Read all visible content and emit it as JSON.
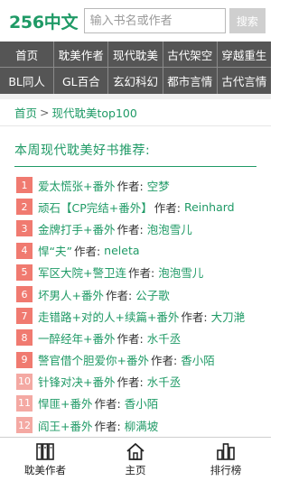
{
  "header": {
    "logo": "256中文",
    "search_placeholder": "输入书名或作者",
    "search_button": "搜索"
  },
  "nav": {
    "row1": [
      "首页",
      "耽美作者",
      "现代耽美",
      "古代架空",
      "穿越重生"
    ],
    "row2": [
      "BL同人",
      "GL百合",
      "玄幻科幻",
      "都市言情",
      "古代言情"
    ]
  },
  "breadcrumb": {
    "home": "首页",
    "separator": ">",
    "current": "现代耽美top100"
  },
  "section_title": "本周现代耽美好书推荐:",
  "author_label": "作者:",
  "books": [
    {
      "rank": "1",
      "title": "爱太慌张+番外",
      "author": "空梦"
    },
    {
      "rank": "2",
      "title": "顽石【CP完结+番外】",
      "author": "Reinhard"
    },
    {
      "rank": "3",
      "title": "金牌打手+番外",
      "author": "泡泡雪儿"
    },
    {
      "rank": "4",
      "title": "悍“夫”",
      "author": "neleta"
    },
    {
      "rank": "5",
      "title": "军区大院+警卫连",
      "author": "泡泡雪儿"
    },
    {
      "rank": "6",
      "title": "坏男人+番外",
      "author": "公子歌"
    },
    {
      "rank": "7",
      "title": "走错路+对的人+续篇+番外",
      "author": "大刀滟"
    },
    {
      "rank": "8",
      "title": "一醉经年+番外",
      "author": "水千丞"
    },
    {
      "rank": "9",
      "title": "警官借个胆爱你+番外",
      "author": "香小陌"
    },
    {
      "rank": "10",
      "title": "针锋对决+番外",
      "author": "水千丞"
    },
    {
      "rank": "11",
      "title": "悍匪+番外",
      "author": "香小陌"
    },
    {
      "rank": "12",
      "title": "阎王+番外",
      "author": "柳满坡"
    }
  ],
  "bottom_tabs": [
    {
      "label": "耽美作者",
      "icon": "books-icon"
    },
    {
      "label": "主页",
      "icon": "home-icon"
    },
    {
      "label": "排行榜",
      "icon": "ranking-icon"
    }
  ],
  "colors": {
    "brand": "#1f9a66",
    "nav_bg": "#555555",
    "rank_hot": "#f07a70",
    "rank_cold": "#f4a9a3"
  }
}
